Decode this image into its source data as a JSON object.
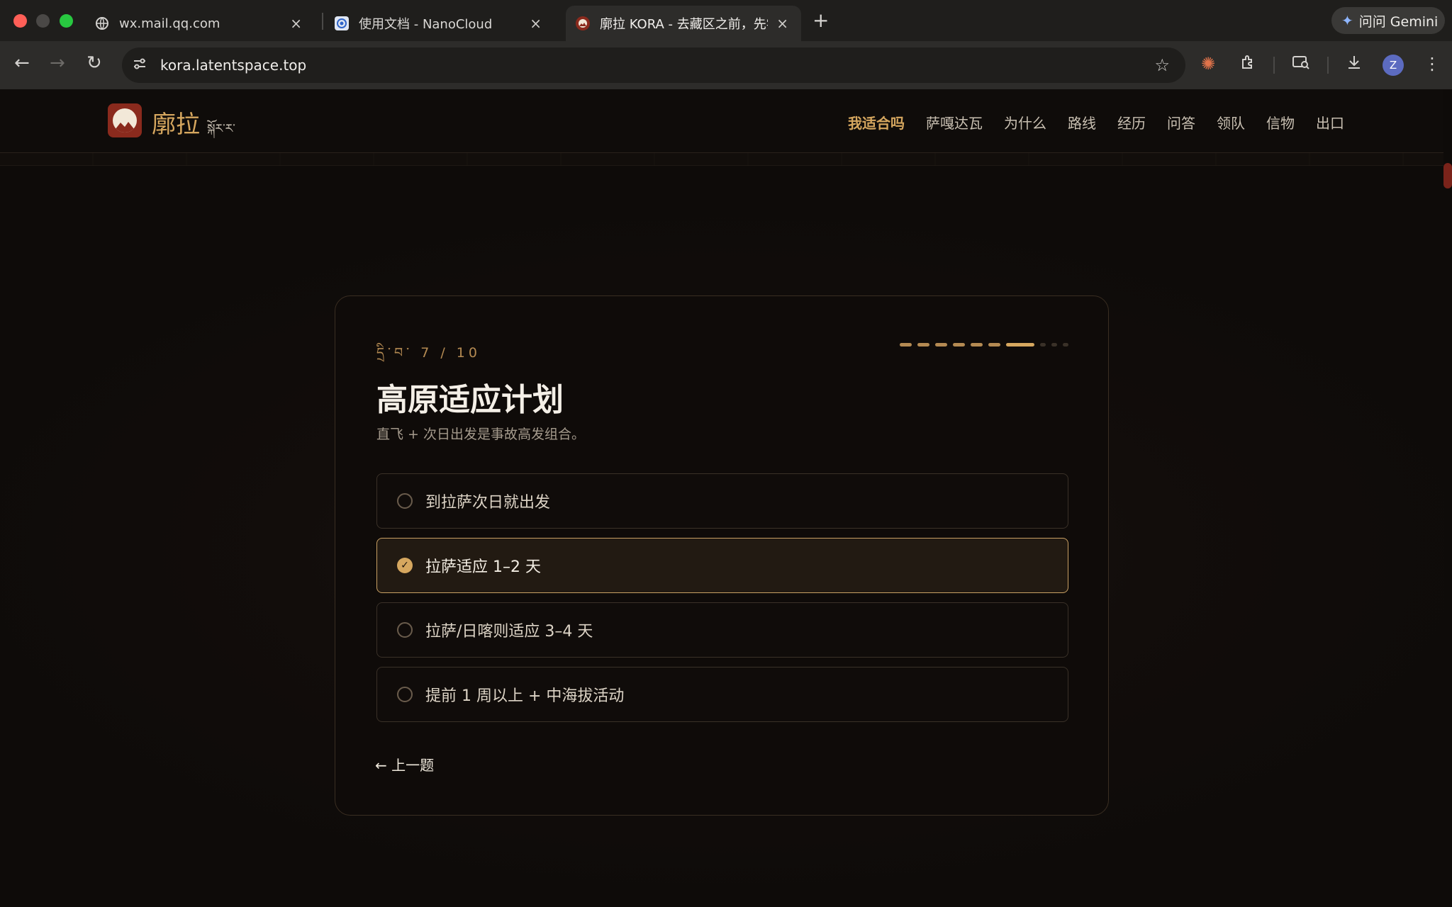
{
  "browser": {
    "tabs": [
      {
        "title": "wx.mail.qq.com",
        "icon": "globe-icon"
      },
      {
        "title": "使用文档 - NanoCloud",
        "icon": "nanocloud-icon"
      },
      {
        "title": "廓拉 KORA - 去藏区之前，先学",
        "icon": "kora-icon"
      }
    ],
    "new_tab": "+",
    "close_glyph": "×",
    "gemini_label": "问问 Gemini",
    "url": "kora.latentspace.top",
    "avatar_letter": "Z"
  },
  "site": {
    "brand": "廓拉",
    "brand_tibetan": "སྐོར་ར་",
    "nav": [
      "我适合吗",
      "萨嘎达瓦",
      "为什么",
      "路线",
      "经历",
      "问答",
      "领队",
      "信物",
      "出口"
    ],
    "active_nav": "我适合吗"
  },
  "quiz": {
    "step_label": "དྲི་བ་ 7 / 10",
    "progress": {
      "current": 7,
      "total": 10
    },
    "title": "高原适应计划",
    "subtitle": "直飞 + 次日出发是事故高发组合。",
    "options": [
      {
        "label": "到拉萨次日就出发",
        "selected": false
      },
      {
        "label": "拉萨适应 1–2 天",
        "selected": true
      },
      {
        "label": "拉萨/日喀则适应 3–4 天",
        "selected": false
      },
      {
        "label": "提前 1 周以上 + 中海拔活动",
        "selected": false
      }
    ],
    "back_label": "← 上一题",
    "check_glyph": "✓"
  },
  "colors": {
    "accent": "#d6a75f",
    "brand_red": "#8a2a1d",
    "background": "#0e0b09"
  }
}
